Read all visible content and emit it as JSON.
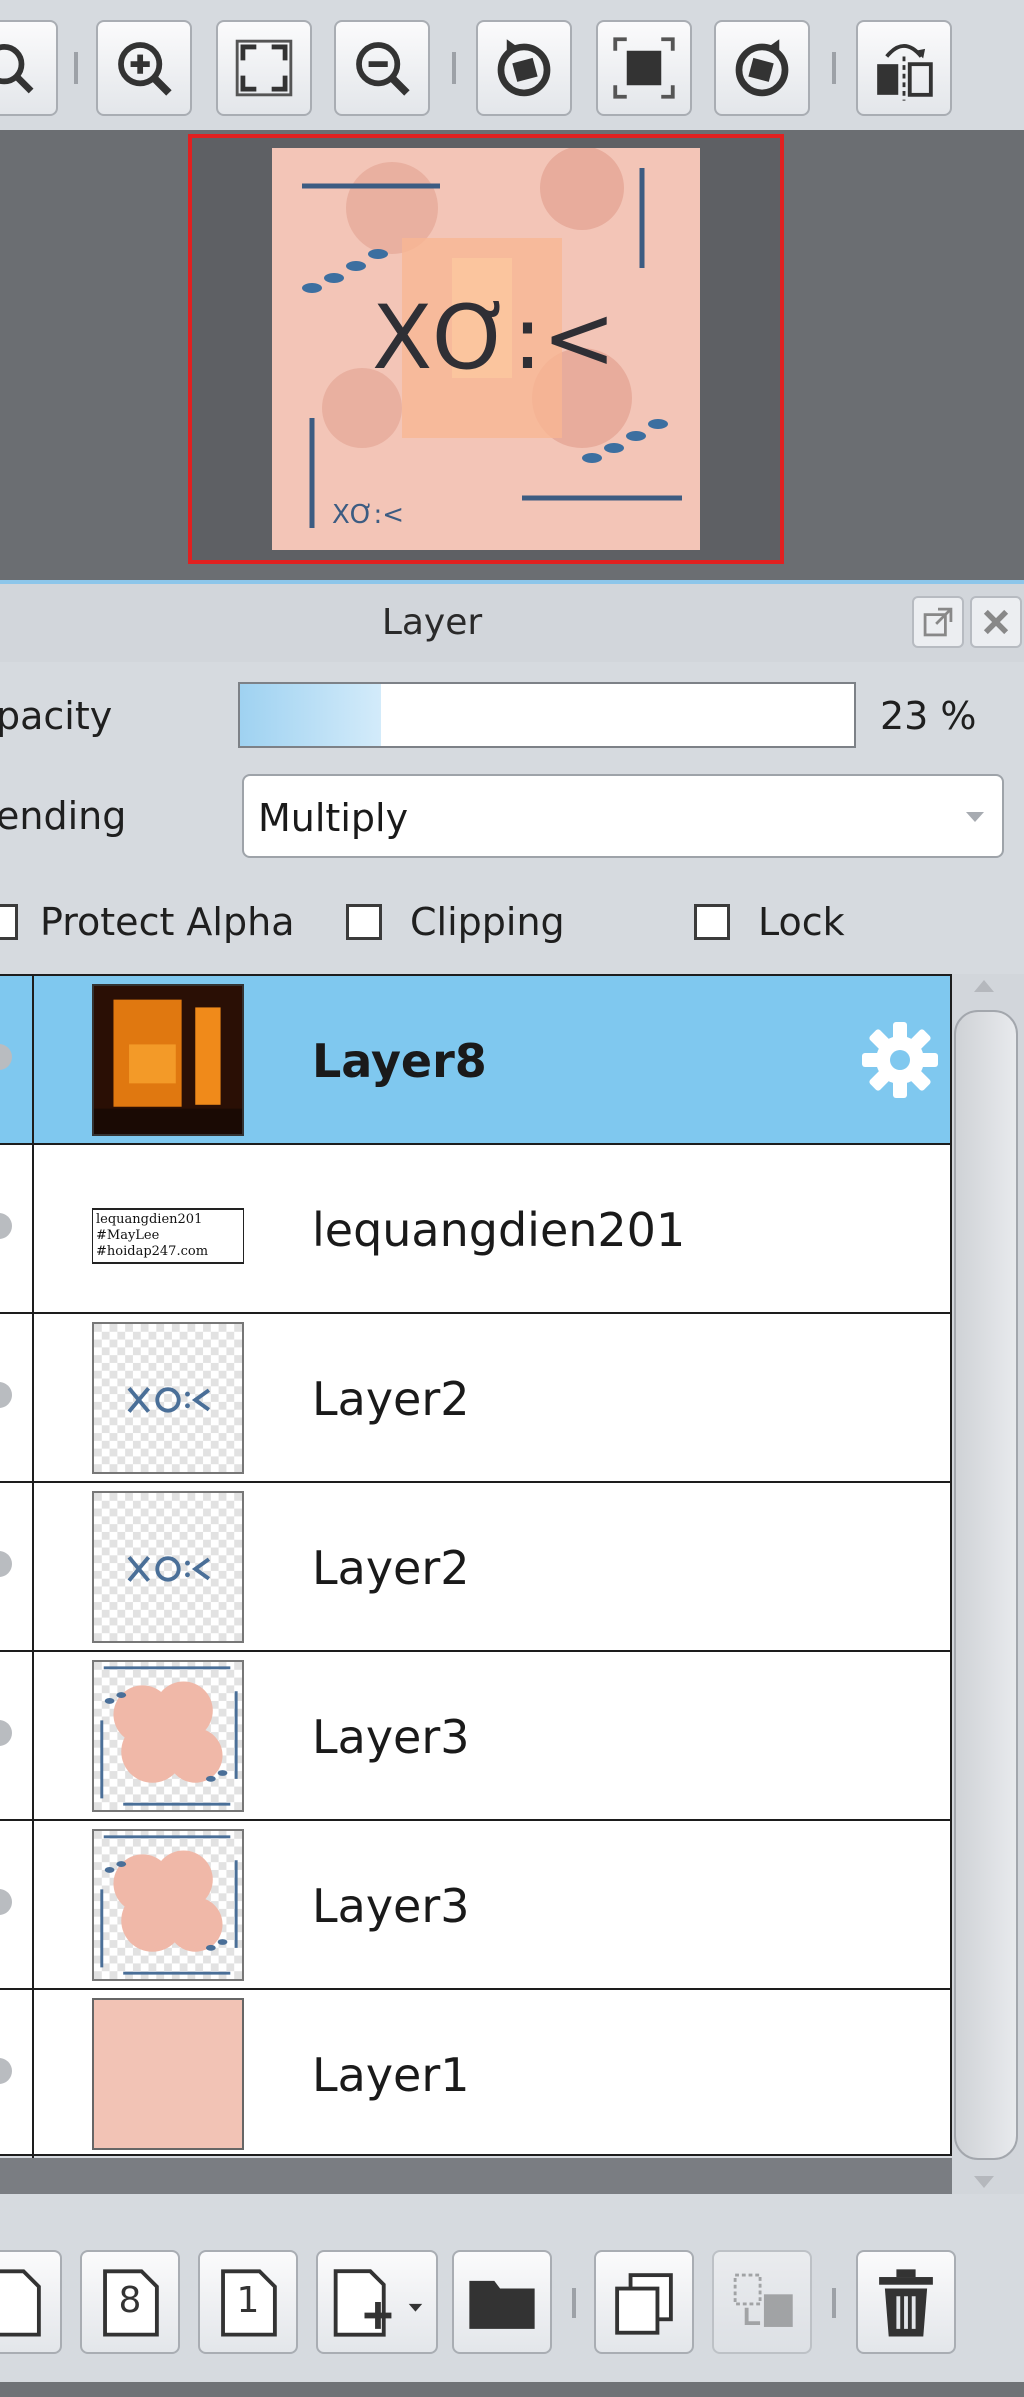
{
  "toolbar": {
    "buttons": [
      "zoom-icon",
      "zoom-in-icon",
      "fit-to-window-icon",
      "zoom-out-icon",
      "rotate-left-icon",
      "actual-size-icon",
      "rotate-right-icon",
      "flip-horizontal-icon"
    ]
  },
  "navigator": {
    "preview_text_large": "XƠ:<",
    "preview_text_small": "XƠ:<"
  },
  "panel": {
    "title": "Layer",
    "opacity_label": "pacity",
    "opacity_value": "23 %",
    "opacity_fraction": 0.23,
    "blending_label": "ending",
    "blending_value": "Multiply",
    "protect_alpha_label": "Protect Alpha",
    "clipping_label": "Clipping",
    "lock_label": "Lock"
  },
  "layers": [
    {
      "name": "Layer8",
      "thumb": "orange-photo",
      "active": true
    },
    {
      "name": "lequangdien201",
      "thumb": "text-stamp",
      "active": false,
      "thumb_text": [
        "lequangdien201",
        "#MayLee",
        "#hoidap247.com"
      ]
    },
    {
      "name": "Layer2",
      "thumb": "xo-logo",
      "active": false
    },
    {
      "name": "Layer2",
      "thumb": "xo-logo",
      "active": false
    },
    {
      "name": "Layer3",
      "thumb": "pink-clouds",
      "active": false
    },
    {
      "name": "Layer3",
      "thumb": "pink-clouds",
      "active": false
    },
    {
      "name": "Layer1",
      "thumb": "pink-fill",
      "active": false
    }
  ],
  "bottom_bar": {
    "layer8_button": "8",
    "layer1_button": "1"
  },
  "colors": {
    "active_row": "#7fc8ef",
    "opacity_fill": "#9fd2f1",
    "navigator_border": "#e02020",
    "peach": "#f2c3b5"
  }
}
